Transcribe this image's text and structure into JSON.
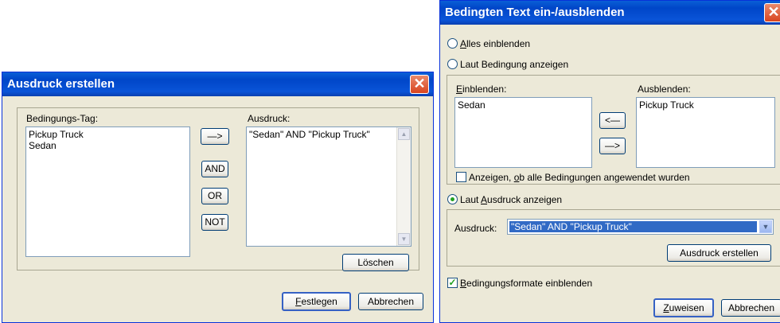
{
  "left_dialog": {
    "title": "Ausdruck erstellen",
    "tag_label": "Bedingungs-Tag:",
    "tags": [
      "Pickup Truck",
      "Sedan"
    ],
    "expression_label": "Ausdruck:",
    "expression_value": "\"Sedan\" AND \"Pickup Truck\"",
    "arrow_button": "—>",
    "and_button": "AND",
    "or_button": "OR",
    "not_button": "NOT",
    "delete_button": "Löschen",
    "ok_button": {
      "u": "F",
      "rest": "estlegen"
    },
    "cancel_button": "Abbrechen",
    "close_icon": "close-icon"
  },
  "right_dialog": {
    "title": "Bedingten Text ein-/ausblenden",
    "radio_show_all": {
      "u": "A",
      "rest": "lles einblenden"
    },
    "radio_by_condition": "Laut Bedingung anzeigen",
    "show_label": {
      "u": "E",
      "rest": "inblenden:"
    },
    "show_items": [
      "Sedan"
    ],
    "hide_label": "Ausblenden:",
    "hide_items": [
      "Pickup Truck"
    ],
    "move_left_button": "<—",
    "move_right_button": "—>",
    "show_applied_checkbox": {
      "pre": "Anzeigen, ",
      "u": "o",
      "rest": "b alle Bedingungen angewendet wurden"
    },
    "radio_by_expression": {
      "pre": "Laut ",
      "u": "A",
      "rest": "usdruck anzeigen"
    },
    "expression_label": "Ausdruck:",
    "expression_value": "\"Sedan\" AND \"Pickup Truck\"",
    "build_expression_button": "Ausdruck erstellen",
    "show_formats_checkbox": {
      "u": "B",
      "rest": "edingungsformate einblenden"
    },
    "apply_button": {
      "u": "Z",
      "rest": "uweisen"
    },
    "cancel_button": "Abbrechen",
    "selected_radio": "by_expression",
    "accent_color": "#316ac5"
  }
}
